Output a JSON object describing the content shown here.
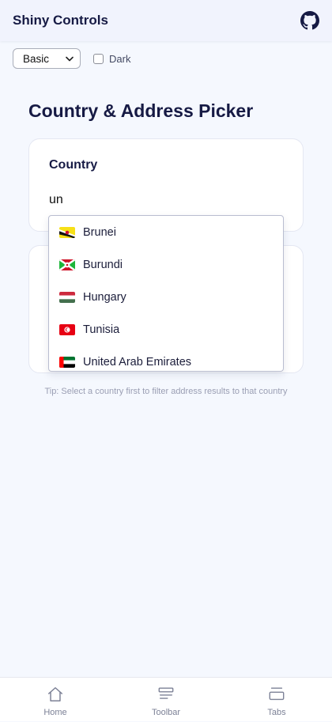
{
  "header": {
    "title": "Shiny Controls",
    "github_icon": "github-icon"
  },
  "controls": {
    "theme_select": {
      "selected": "Basic"
    },
    "dark_checkbox": {
      "label": "Dark",
      "checked": false
    }
  },
  "page": {
    "title": "Country & Address Picker"
  },
  "country_card": {
    "label": "Country",
    "input_value": "un"
  },
  "dropdown": {
    "options": [
      {
        "label": "Brunei",
        "flag": "brunei-flag-icon"
      },
      {
        "label": "Burundi",
        "flag": "burundi-flag-icon"
      },
      {
        "label": "Hungary",
        "flag": "hungary-flag-icon"
      },
      {
        "label": "Tunisia",
        "flag": "tunisia-flag-icon"
      },
      {
        "label": "United Arab Emirates",
        "flag": "uae-flag-icon"
      }
    ]
  },
  "tip": "Tip: Select a country first to filter address results to that country",
  "bottom_nav": {
    "items": [
      {
        "label": "Home",
        "icon": "home-icon"
      },
      {
        "label": "Toolbar",
        "icon": "toolbar-icon"
      },
      {
        "label": "Tabs",
        "icon": "tabs-icon"
      }
    ]
  },
  "colors": {
    "background": "#f5f8fe",
    "header_background": "#f1f3fd",
    "title_text": "#161a44",
    "muted_text": "#9a9eb3"
  }
}
